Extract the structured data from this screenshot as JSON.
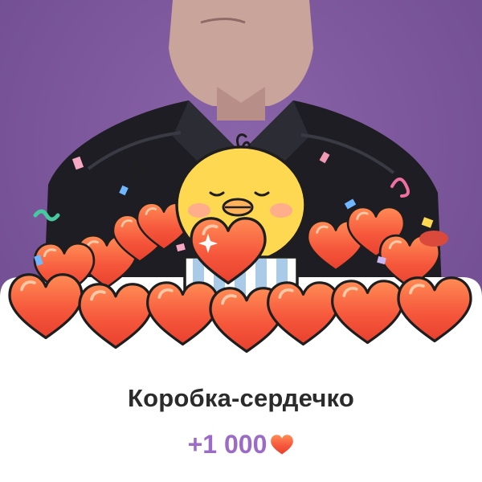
{
  "gift": {
    "title": "Коробка-сердечко",
    "reward_text": "+1 000",
    "reward_icon": "heart-icon"
  },
  "colors": {
    "background_purple": "#7f5a9c",
    "jacket": "#1d1d23",
    "heart_red": "#f4513b",
    "heart_orange": "#ff8a50",
    "chick_yellow": "#ffd852",
    "box_blue": "#a9cbe8",
    "reward_purple": "#9b6bc7",
    "title_text": "#2b2b2b"
  }
}
